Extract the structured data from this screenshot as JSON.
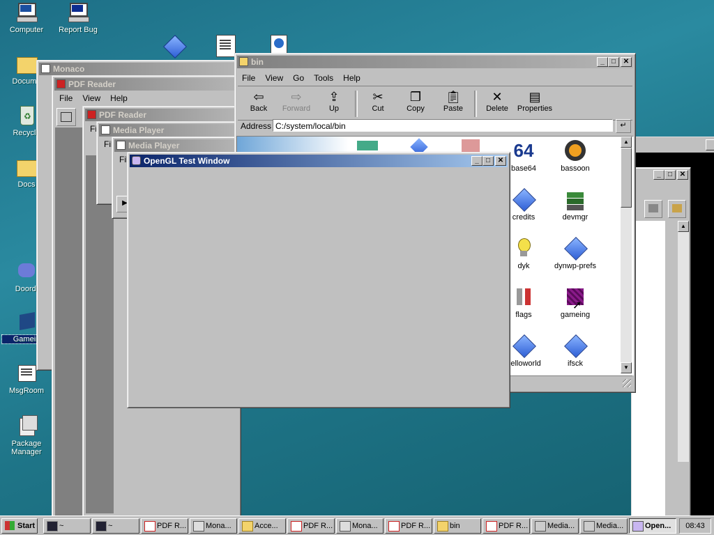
{
  "desktop": {
    "icons": [
      {
        "label": "Computer"
      },
      {
        "label": "Report Bug"
      },
      {
        "label": "Docume"
      },
      {
        "label": "Recycle"
      },
      {
        "label": "Docs"
      },
      {
        "label": "Doordi"
      },
      {
        "label": "Gamein"
      },
      {
        "label": "MsgRoom"
      },
      {
        "label": "Package Manager"
      }
    ]
  },
  "windows": {
    "monaco": {
      "title": "Monaco"
    },
    "pdf1": {
      "title": "PDF Reader",
      "menu": [
        "File",
        "View",
        "Help"
      ]
    },
    "pdf2": {
      "title": "PDF Reader",
      "menu_fragment": "File"
    },
    "media1": {
      "title": "Media Player",
      "menu_fragment": "File"
    },
    "media2": {
      "title": "Media Player",
      "menu_fragment": "File"
    },
    "opengl": {
      "title": "OpenGL Test Window"
    },
    "bin": {
      "title": "bin",
      "menu": [
        "File",
        "View",
        "Go",
        "Tools",
        "Help"
      ],
      "toolbar": [
        "Back",
        "Forward",
        "Up",
        "Cut",
        "Copy",
        "Paste",
        "Delete",
        "Properties"
      ],
      "address_label": "Address",
      "address_value": "C:/system/local/bin",
      "files": [
        "base64",
        "bassoon",
        "credits",
        "devmgr",
        "dyk",
        "dynwp-prefs",
        "flags",
        "gameing",
        "helloworld",
        "ifsck"
      ],
      "base64_glyph": "64"
    }
  },
  "taskbar": {
    "start": "Start",
    "buttons": [
      "~",
      "~",
      "PDF R...",
      "Mona...",
      "Acce...",
      "PDF R...",
      "Mona...",
      "PDF R...",
      "bin",
      "PDF R...",
      "Media...",
      "Media...",
      "Open..."
    ],
    "clock": "08:43"
  }
}
